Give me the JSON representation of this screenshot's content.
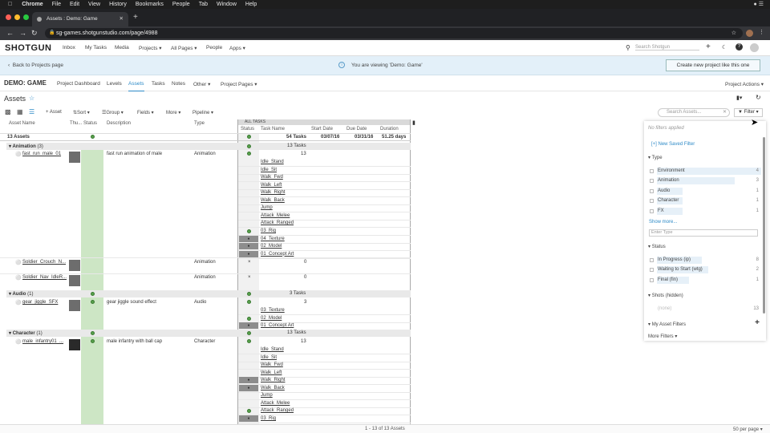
{
  "menubar": {
    "items": [
      "Chrome",
      "File",
      "Edit",
      "View",
      "History",
      "Bookmarks",
      "People",
      "Tab",
      "Window",
      "Help"
    ]
  },
  "browser": {
    "tab_title": "Assets : Demo: Game",
    "url": "sg-games.shotgunstudio.com/page/4988"
  },
  "header": {
    "logo": "SHOTGUN",
    "nav": [
      "Inbox",
      "My Tasks",
      "Media",
      "Projects",
      "All Pages",
      "People",
      "Apps"
    ],
    "search_placeholder": "Search Shotgun"
  },
  "banner": {
    "back": "Back to Projects page",
    "message": "You are viewing 'Demo: Game'",
    "button": "Create new project like this one"
  },
  "project": {
    "name": "DEMO: GAME",
    "tabs": [
      "Project Dashboard",
      "Levels",
      "Assets",
      "Tasks",
      "Notes",
      "Other",
      "Project Pages"
    ],
    "actions": "Project Actions"
  },
  "page": {
    "title": "Assets"
  },
  "toolbar": {
    "add": "+ Asset",
    "sort": "Sort",
    "group": "Group",
    "fields": "Fields",
    "more": "More",
    "pipeline": "Pipeline",
    "search_placeholder": "Search Assets...",
    "filter": "Filter"
  },
  "grid": {
    "columns": [
      "Asset Name",
      "Thu...",
      "Status",
      "Description",
      "Type"
    ],
    "task_columns": [
      "Status",
      "Task Name",
      "Start Date",
      "Due Date",
      "Duration"
    ],
    "all_tasks_label": "ALL TASKS",
    "summary": {
      "assets": "13 Assets",
      "tasks": "54 Tasks",
      "start": "03/07/16",
      "due": "03/31/16",
      "duration": "51.25 days"
    },
    "groups": [
      {
        "label": "Animation",
        "count": "(3)",
        "tasks": "13 Tasks"
      },
      {
        "label": "Audio",
        "count": "(1)",
        "tasks": "3 Tasks"
      },
      {
        "label": "Character",
        "count": "(1)",
        "tasks": "13 Tasks"
      }
    ],
    "assets": [
      {
        "name": "fast_run_male_01",
        "desc": "fast run animation of male",
        "type": "Animation",
        "tasks": "13"
      },
      {
        "name": "Soldier_Crouch_N...",
        "desc": "",
        "type": "Animation",
        "tasks": "0"
      },
      {
        "name": "Soldier_Nav_IdleR...",
        "desc": "",
        "type": "Animation",
        "tasks": "0"
      },
      {
        "name": "gear_jiggle_SFX",
        "desc": "gear jiggle sound effect",
        "type": "Audio",
        "tasks": "3"
      },
      {
        "name": "male_infantry01_...",
        "desc": "male infantry with ball cap",
        "type": "Character",
        "tasks": "13"
      }
    ],
    "task_names_a": [
      "Idle_Stand",
      "Idle_Sit",
      "Walk_Fwd",
      "Walk_Left",
      "Walk_Right",
      "Walk_Back",
      "Jump",
      "Attack_Melee",
      "Attack_Ranged",
      "03_Rig",
      "04_Texture",
      "02_Model",
      "01_Concept Art"
    ],
    "task_names_b": [
      "03_Texture",
      "02_Model",
      "01_Concept Art"
    ],
    "task_names_c": [
      "Idle_Stand",
      "Idle_Sit",
      "Walk_Fwd",
      "Walk_Left",
      "Walk_Right",
      "Walk_Back",
      "Jump",
      "Attack_Melee",
      "Attack_Ranged",
      "03_Rig"
    ]
  },
  "filter_panel": {
    "no_filters": "No filters applied",
    "new_saved": "[+] New Saved Filter",
    "type_section": "Type",
    "types": [
      {
        "label": "Environment",
        "count": "4"
      },
      {
        "label": "Animation",
        "count": "3"
      },
      {
        "label": "Audio",
        "count": "1"
      },
      {
        "label": "Character",
        "count": "1"
      },
      {
        "label": "FX",
        "count": "1"
      }
    ],
    "show_more": "Show more...",
    "type_placeholder": "Enter Type",
    "status_section": "Status",
    "statuses": [
      {
        "label": "In Progress (ip)",
        "count": "8"
      },
      {
        "label": "Waiting to Start (wtg)",
        "count": "2"
      },
      {
        "label": "Final (fin)",
        "count": "1"
      }
    ],
    "shots_section": "Shots (hidden)",
    "shots_hidden": "(none)",
    "shots_count": "13",
    "my_filters": "My Asset Filters",
    "more_filters": "More Filters"
  },
  "footer": {
    "count": "1 - 13 of 13 Assets",
    "per_page": "50 per page"
  },
  "colors": {
    "accent": "#2d8ac7",
    "banner": "#e3f0f9",
    "status_green": "#57a04c",
    "selected_col": "#cde6c5"
  }
}
